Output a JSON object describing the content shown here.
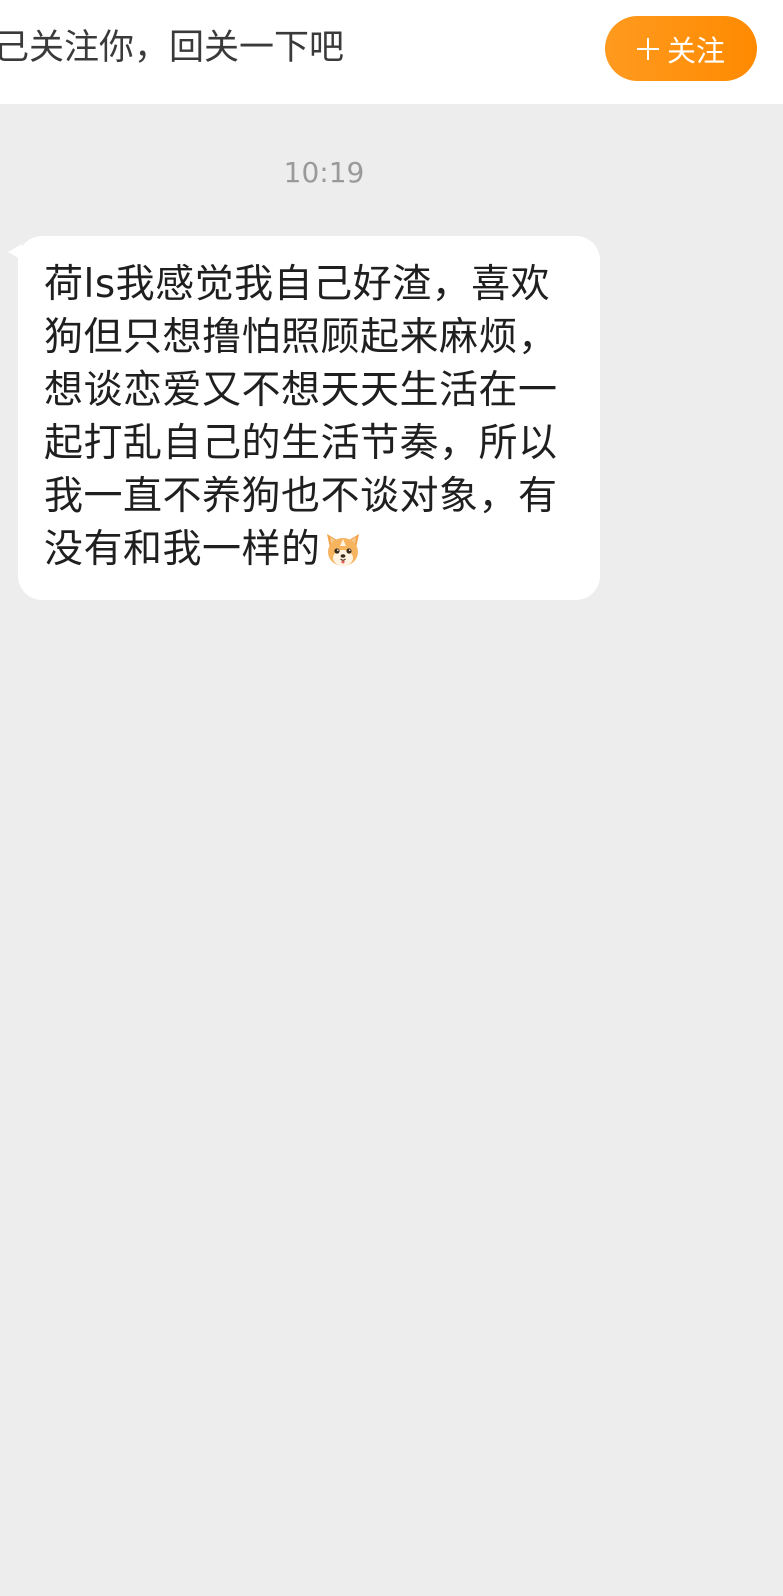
{
  "header": {
    "follow_prompt": "己关注你，回关一下吧",
    "follow_button_label": "关注"
  },
  "chat": {
    "timestamp": "10:19",
    "message": "荷ls我感觉我自己好渣，喜欢狗但只想撸怕照顾起来麻烦，想谈恋爱又不想天天生活在一起打乱自己的生活节奏，所以我一直不养狗也不谈对象，有没有和我一样的"
  },
  "icons": {
    "follow_plus": "plus-icon",
    "message_emoji": "dog-face-emoji"
  },
  "colors": {
    "background": "#ededed",
    "accent": "#ff8a00",
    "bubble": "#ffffff"
  }
}
